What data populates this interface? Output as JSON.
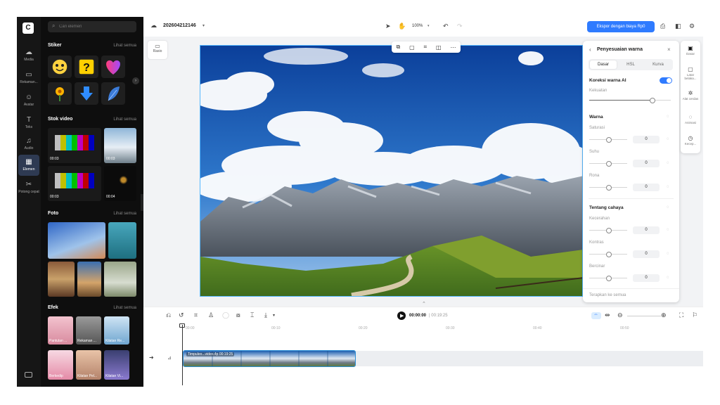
{
  "app": {
    "logo_glyph": "C"
  },
  "rail": {
    "items": [
      {
        "label": "Media",
        "icon": "cloud-upload-icon",
        "glyph": "☁"
      },
      {
        "label": "Rekaman...",
        "icon": "record-icon",
        "glyph": "▭"
      },
      {
        "label": "Avatar",
        "icon": "avatar-icon",
        "glyph": "☺"
      },
      {
        "label": "Teks",
        "icon": "text-icon",
        "glyph": "T"
      },
      {
        "label": "Audio",
        "icon": "audio-icon",
        "glyph": "♫"
      },
      {
        "label": "Elemen",
        "icon": "elements-icon",
        "glyph": "▦"
      },
      {
        "label": "Potong cepat",
        "icon": "quick-cut-icon",
        "glyph": "✂"
      }
    ],
    "bottom_icon": "keyboard-icon"
  },
  "panel": {
    "search_placeholder": "Cari elemen",
    "sections": {
      "stiker": {
        "title": "Stiker",
        "more": "Lihat semua"
      },
      "stok_video": {
        "title": "Stok video",
        "more": "Lihat semua",
        "durations": [
          "00:03",
          "00:03",
          "00:03",
          "00:04"
        ]
      },
      "foto": {
        "title": "Foto",
        "more": "Lihat semua"
      },
      "efek": {
        "title": "Efek",
        "more": "Lihat semua",
        "items": [
          "Pantulan ...",
          "Rekaman ...",
          "Kilatan Re...",
          "Berkedip",
          "Kilatan Pel...",
          "Kilatan Vi..."
        ]
      }
    }
  },
  "topbar": {
    "project_name": "202604212146",
    "zoom": "100%",
    "export_label": "Ekspor dengan biaya Rp0"
  },
  "stage": {
    "ratio_label": "Rasio"
  },
  "adjust": {
    "title": "Penyesuaian warna",
    "tabs": [
      "Dasar",
      "HSL",
      "Kurva"
    ],
    "ai_label": "Koreksi warna AI",
    "ai_sub": "Kekuatan",
    "warna_title": "Warna",
    "sliders_warna": [
      {
        "label": "Saturasi",
        "value": "0"
      },
      {
        "label": "Suhu",
        "value": "0"
      },
      {
        "label": "Rona",
        "value": "0"
      }
    ],
    "cahaya_title": "Tentang cahaya",
    "sliders_cahaya": [
      {
        "label": "Kecerahan",
        "value": "0"
      },
      {
        "label": "Kontras",
        "value": "0"
      },
      {
        "label": "Bercinar",
        "value": "0"
      }
    ],
    "footer": "Terapkan ke semua"
  },
  "prop_rail": [
    {
      "label": "Dasar",
      "icon": "basic-icon",
      "glyph": "▣"
    },
    {
      "label": "Latar belaka...",
      "icon": "background-icon",
      "glyph": "▢"
    },
    {
      "label": "Alat cerdas",
      "icon": "smart-tools-icon",
      "glyph": "✲"
    },
    {
      "label": "Animasi",
      "icon": "animation-icon",
      "glyph": "◌"
    },
    {
      "label": "Kecep...",
      "icon": "speed-icon",
      "glyph": "◷"
    }
  ],
  "timeline": {
    "current_time": "00:00:00",
    "total_time": "| 00:19:25",
    "ruler_ticks": [
      "00:00",
      "00:10",
      "00:20",
      "00:30",
      "00:40",
      "00:50"
    ],
    "clip_label": "Timpuleo...video.4p   00:19:25"
  },
  "colors": {
    "accent": "#2f7bff",
    "rail_bg": "#161616",
    "panel_bg": "#0e0e0e",
    "stage_bg": "#f2f3f5"
  }
}
